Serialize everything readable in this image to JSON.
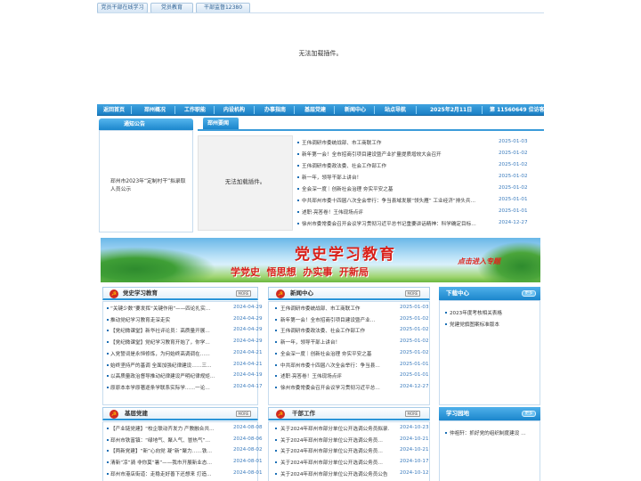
{
  "top_tabs": [
    "党员干部在线学习",
    "党员教育",
    "干部监督12380"
  ],
  "plugin_message_main": "无法加载插件。",
  "nav": {
    "items": [
      "返回首页",
      "邳州概况",
      "工作职能",
      "内设机构",
      "办事指南",
      "基层党建",
      "新闻中心",
      "站点导航"
    ],
    "date": "2025年2月11日",
    "visitor": "第 11560649 位访客"
  },
  "notice": {
    "title": "通知公告",
    "item": "邳州市2023年“定制村干”拟录取人员公示"
  },
  "news_top": {
    "tab": "邳州要闻",
    "plugin_message": "无法加载插件。",
    "items": [
      {
        "title": "王伟调研市委统战部、市工商联工作",
        "date": "2025-01-03"
      },
      {
        "title": "新年第一会！全市招商引项目建设暨产业扩量提质增效大会召开",
        "date": "2025-01-02"
      },
      {
        "title": "王伟调研市委政法委、社会工作部工作",
        "date": "2025-01-02"
      },
      {
        "title": "新一年，领导干部上讲台！",
        "date": "2025-01-02"
      },
      {
        "title": "全会深一度｜创新社会治理 夯实平安之基",
        "date": "2025-01-02"
      },
      {
        "title": "中共邳州市委十四届八次全会举行：争当县域发展“领头雁” 工业经济“排头兵…",
        "date": "2025-01-01"
      },
      {
        "title": "述职·亮答卷！王伟现场点评",
        "date": "2025-01-01"
      },
      {
        "title": "徐州市委常委会召开会议学习贯彻习近平总书记重要讲话精神：科学确定目标…",
        "date": "2024-12-27"
      }
    ]
  },
  "banner": {
    "title": "党史学习教育",
    "slogan": "学党史  悟思想  办实事  开新局",
    "cta": "点击进入专题"
  },
  "sec_party_history": {
    "title": "党史学习教育",
    "more": "MORE",
    "items": [
      {
        "title": "“关键少数”要发挥“关键作用”——四论扎实…",
        "date": "2024-04-29"
      },
      {
        "title": "推动党纪学习教育走深走实",
        "date": "2024-04-29"
      },
      {
        "title": "【党纪微课堂】新华社评论员：高质量开展…",
        "date": "2024-04-29"
      },
      {
        "title": "【党纪微课堂】党纪学习教育开始了，你学…",
        "date": "2024-04-29"
      },
      {
        "title": "入党誓词是永恒修炼，为何始终高调调在……",
        "date": "2024-04-21"
      },
      {
        "title": "始终坚持严的基调 全面加强纪律建设……三…",
        "date": "2024-04-21"
      },
      {
        "title": "以高质量政治督导推动纪律建设严明纪律规矩…",
        "date": "2024-04-19"
      },
      {
        "title": "原原本本学原著逐条学联系实际学……一论…",
        "date": "2024-04-17"
      }
    ]
  },
  "sec_news_center": {
    "title": "新闻中心",
    "more": "MORE",
    "items": [
      {
        "title": "王伟调研市委统战部、市工商联工作",
        "date": "2025-01-03"
      },
      {
        "title": "新年第一会！全市招商引项目建设暨产业…",
        "date": "2025-01-02"
      },
      {
        "title": "王伟调研市委政法委、社会工作部工作",
        "date": "2025-01-02"
      },
      {
        "title": "新一年，领导干部上讲台！",
        "date": "2025-01-02"
      },
      {
        "title": "全会深一度｜创新社会治理 夯实平安之基",
        "date": "2025-01-02"
      },
      {
        "title": "中共邳州市委十四届八次全会举行：争当县…",
        "date": "2025-01-01"
      },
      {
        "title": "述职·亮答卷！王伟现场点评",
        "date": "2025-01-01"
      },
      {
        "title": "徐州市委常委会召开会议学习贯彻习近平总…",
        "date": "2024-12-27"
      }
    ]
  },
  "downloads": {
    "title": "下载中心",
    "more": "更多",
    "items": [
      "2023年度考核相关表格",
      "党建党旗图案标准版本"
    ]
  },
  "sec_grassroots": {
    "title": "基层党建",
    "more": "MORE",
    "items": [
      {
        "title": "【产业链党建】“校企联动齐发力 产教融合共…",
        "date": "2024-08-08"
      },
      {
        "title": "邳州市铁富镇：“绿地气、聚人气、冒热气”…",
        "date": "2024-08-06"
      },
      {
        "title": "【两新党建】“新”心向党 凝“新”聚力……铁…",
        "date": "2024-08-02"
      },
      {
        "title": "清新“凉”骑 非你莫“暑”——我市开展新业态…",
        "date": "2024-08-01"
      },
      {
        "title": "邳州市港店街道：走稳走好善下还想来 打造…",
        "date": "2024-08-01"
      }
    ]
  },
  "sec_cadre": {
    "title": "干部工作",
    "more": "MORE",
    "items": [
      {
        "title": "关于2024年邳州市部分单位公开选调公务员拟录…",
        "date": "2024-10-23"
      },
      {
        "title": "关于2024年邳州市部分单位公开选调公务员…",
        "date": "2024-10-21"
      },
      {
        "title": "关于2024年邳州市部分单位公开选调公务员…",
        "date": "2024-10-21"
      },
      {
        "title": "关于2024年邳州市部分单位公开选调公务员…",
        "date": "2024-10-17"
      },
      {
        "title": "关于2024年邳州市部分单位公开选调公务员公告",
        "date": "2024-10-12"
      }
    ]
  },
  "study_garden": {
    "title": "学习园地",
    "more": "更多",
    "items": [
      "仲祖轩：抓好党的组织制度建设 …"
    ]
  }
}
